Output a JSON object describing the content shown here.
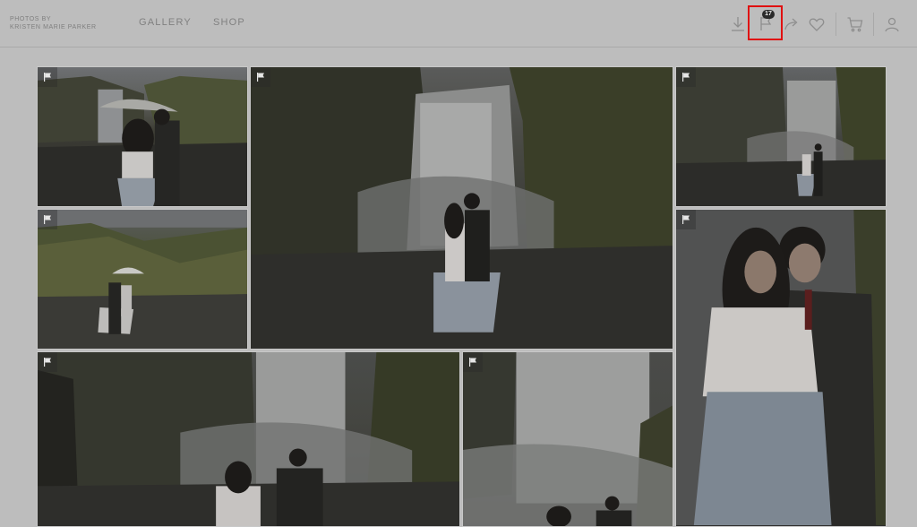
{
  "brand": {
    "line1": "PHOTOS BY",
    "line2": "KRISTEN MARIE PARKER"
  },
  "nav": {
    "gallery": "GALLERY",
    "shop": "SHOP"
  },
  "toolbar": {
    "flag_count": "17",
    "icons": [
      "download-icon",
      "flag-icon",
      "share-icon",
      "heart-icon",
      "cart-icon",
      "user-icon"
    ],
    "highlight_color": "#e01010"
  },
  "gallery": {
    "photo_count": 7,
    "flag_icon": "flag-icon"
  }
}
